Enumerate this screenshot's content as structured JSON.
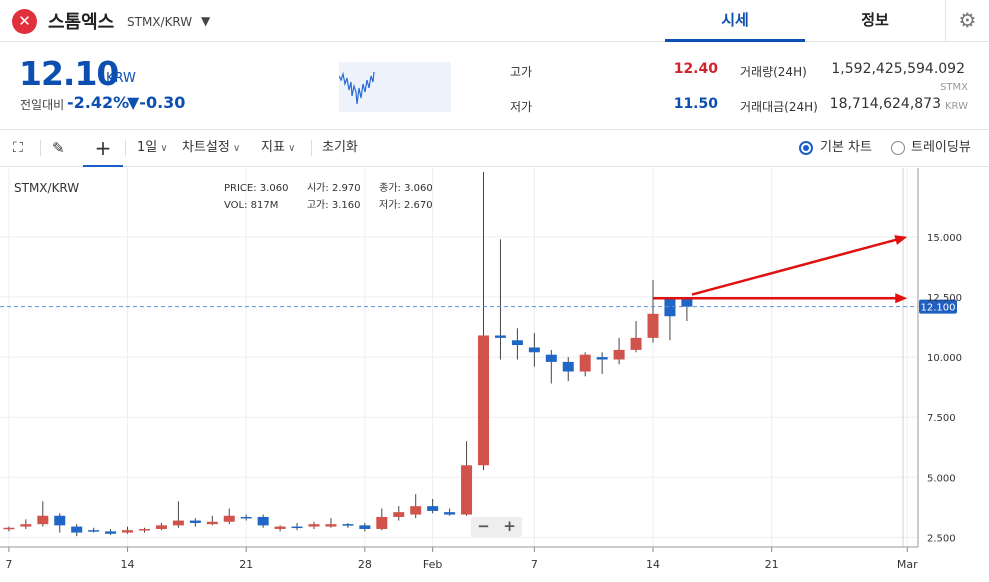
{
  "header": {
    "logo_glyph": "✕",
    "coin_name": "스톰엑스",
    "pair": "STMX/KRW",
    "tabs": [
      {
        "label": "시세"
      },
      {
        "label": "정보"
      }
    ],
    "settings_icon": "gear-icon"
  },
  "ticker": {
    "price": "12.10",
    "price_unit": "KRW",
    "change_label": "전일대비",
    "change_pct": "-2.42%",
    "change_abs": "▼-0.30",
    "high_label": "고가",
    "high": "12.40",
    "low_label": "저가",
    "low": "11.50",
    "volume_label": "거래량(24H)",
    "volume": "1,592,425,594.092",
    "volume_unit": "STMX",
    "amount_label": "거래대금(24H)",
    "amount": "18,714,624,873",
    "amount_unit": "KRW",
    "colors": {
      "up": "#d2232a",
      "down": "#0d4fb0"
    }
  },
  "toolbar": {
    "interval": "1일",
    "chart_settings": "차트설정",
    "indicators": "지표",
    "reset": "초기화",
    "basic_chart": "기본 차트",
    "tradingview": "트레이딩뷰"
  },
  "legend": {
    "symbol": "STMX/KRW",
    "row1": [
      {
        "k": "PRICE:",
        "v": "3.060"
      },
      {
        "k": "시가:",
        "v": "2.970"
      },
      {
        "k": "종가:",
        "v": "3.060"
      }
    ],
    "row2": [
      {
        "k": "VOL:",
        "v": "817M"
      },
      {
        "k": "고가:",
        "v": "3.160"
      },
      {
        "k": "저가:",
        "v": "2.670"
      }
    ]
  },
  "chart_data": {
    "type": "candlestick",
    "current_price_label": "12.100",
    "current_price": 12.1,
    "y_ticks": [
      "15.000",
      "12.500",
      "10.000",
      "7.500",
      "5.000",
      "2.500"
    ],
    "y_tick_values": [
      15,
      12.5,
      10,
      7.5,
      5,
      2.5
    ],
    "x_ticks": [
      "7",
      "14",
      "21",
      "28",
      "Feb",
      "7",
      "14",
      "21",
      "Mar"
    ],
    "x_tick_days": [
      7,
      14,
      21,
      28,
      32,
      38,
      45,
      52,
      60
    ],
    "ylim": [
      2.1,
      17.7
    ],
    "grid": true,
    "up_color": "#d1534b",
    "down_color": "#1f66c6",
    "candles": [
      {
        "d": 7,
        "o": 2.85,
        "h": 2.95,
        "l": 2.75,
        "c": 2.9
      },
      {
        "d": 8,
        "o": 2.95,
        "h": 3.25,
        "l": 2.85,
        "c": 3.05
      },
      {
        "d": 9,
        "o": 3.05,
        "h": 4.0,
        "l": 2.95,
        "c": 3.4
      },
      {
        "d": 10,
        "o": 3.4,
        "h": 3.5,
        "l": 2.7,
        "c": 3.0
      },
      {
        "d": 11,
        "o": 2.95,
        "h": 3.05,
        "l": 2.55,
        "c": 2.7
      },
      {
        "d": 12,
        "o": 2.8,
        "h": 2.9,
        "l": 2.7,
        "c": 2.75
      },
      {
        "d": 13,
        "o": 2.75,
        "h": 2.85,
        "l": 2.6,
        "c": 2.65
      },
      {
        "d": 14,
        "o": 2.7,
        "h": 2.95,
        "l": 2.65,
        "c": 2.8
      },
      {
        "d": 15,
        "o": 2.8,
        "h": 2.9,
        "l": 2.7,
        "c": 2.85
      },
      {
        "d": 16,
        "o": 2.85,
        "h": 3.1,
        "l": 2.8,
        "c": 3.0
      },
      {
        "d": 17,
        "o": 3.0,
        "h": 4.0,
        "l": 2.9,
        "c": 3.2
      },
      {
        "d": 18,
        "o": 3.2,
        "h": 3.3,
        "l": 2.95,
        "c": 3.1
      },
      {
        "d": 19,
        "o": 3.05,
        "h": 3.4,
        "l": 3.0,
        "c": 3.15
      },
      {
        "d": 20,
        "o": 3.15,
        "h": 3.7,
        "l": 3.05,
        "c": 3.4
      },
      {
        "d": 21,
        "o": 3.35,
        "h": 3.45,
        "l": 3.2,
        "c": 3.3
      },
      {
        "d": 22,
        "o": 3.35,
        "h": 3.45,
        "l": 2.9,
        "c": 3.0
      },
      {
        "d": 23,
        "o": 2.85,
        "h": 3.0,
        "l": 2.75,
        "c": 2.95
      },
      {
        "d": 24,
        "o": 2.95,
        "h": 3.1,
        "l": 2.8,
        "c": 2.9
      },
      {
        "d": 25,
        "o": 2.95,
        "h": 3.15,
        "l": 2.85,
        "c": 3.05
      },
      {
        "d": 26,
        "o": 2.95,
        "h": 3.3,
        "l": 2.9,
        "c": 3.05
      },
      {
        "d": 27,
        "o": 3.05,
        "h": 3.1,
        "l": 2.9,
        "c": 3.0
      },
      {
        "d": 28,
        "o": 3.0,
        "h": 3.1,
        "l": 2.75,
        "c": 2.85
      },
      {
        "d": 29,
        "o": 2.85,
        "h": 3.7,
        "l": 2.8,
        "c": 3.35
      },
      {
        "d": 30,
        "o": 3.35,
        "h": 3.8,
        "l": 3.2,
        "c": 3.55
      },
      {
        "d": 31,
        "o": 3.45,
        "h": 4.3,
        "l": 3.3,
        "c": 3.8
      },
      {
        "d": 32,
        "o": 3.8,
        "h": 4.1,
        "l": 3.5,
        "c": 3.6
      },
      {
        "d": 33,
        "o": 3.55,
        "h": 3.7,
        "l": 3.4,
        "c": 3.45
      },
      {
        "d": 34,
        "o": 3.45,
        "h": 6.5,
        "l": 3.4,
        "c": 5.5
      },
      {
        "d": 35,
        "o": 5.5,
        "h": 17.7,
        "l": 5.3,
        "c": 10.9
      },
      {
        "d": 36,
        "o": 10.9,
        "h": 14.9,
        "l": 9.9,
        "c": 10.8
      },
      {
        "d": 37,
        "o": 10.7,
        "h": 11.2,
        "l": 9.9,
        "c": 10.5
      },
      {
        "d": 38,
        "o": 10.4,
        "h": 11.0,
        "l": 9.6,
        "c": 10.2
      },
      {
        "d": 39,
        "o": 10.1,
        "h": 10.3,
        "l": 8.9,
        "c": 9.8
      },
      {
        "d": 40,
        "o": 9.8,
        "h": 10.0,
        "l": 9.0,
        "c": 9.4
      },
      {
        "d": 41,
        "o": 9.4,
        "h": 10.2,
        "l": 9.2,
        "c": 10.1
      },
      {
        "d": 42,
        "o": 10.0,
        "h": 10.2,
        "l": 9.3,
        "c": 9.9
      },
      {
        "d": 43,
        "o": 9.9,
        "h": 10.8,
        "l": 9.7,
        "c": 10.3
      },
      {
        "d": 44,
        "o": 10.3,
        "h": 11.5,
        "l": 10.2,
        "c": 10.8
      },
      {
        "d": 45,
        "o": 10.8,
        "h": 13.2,
        "l": 10.6,
        "c": 11.8
      },
      {
        "d": 46,
        "o": 12.4,
        "h": 12.5,
        "l": 10.7,
        "c": 11.7
      },
      {
        "d": 47,
        "o": 12.4,
        "h": 12.45,
        "l": 11.5,
        "c": 12.1
      }
    ],
    "annotations": [
      {
        "type": "arrow",
        "from": [
          45,
          12.45
        ],
        "to": [
          60,
          12.45
        ],
        "color": "#e01010"
      },
      {
        "type": "arrow",
        "from": [
          47.3,
          12.6
        ],
        "to": [
          60,
          15.0
        ],
        "color": "#e01010"
      }
    ]
  }
}
